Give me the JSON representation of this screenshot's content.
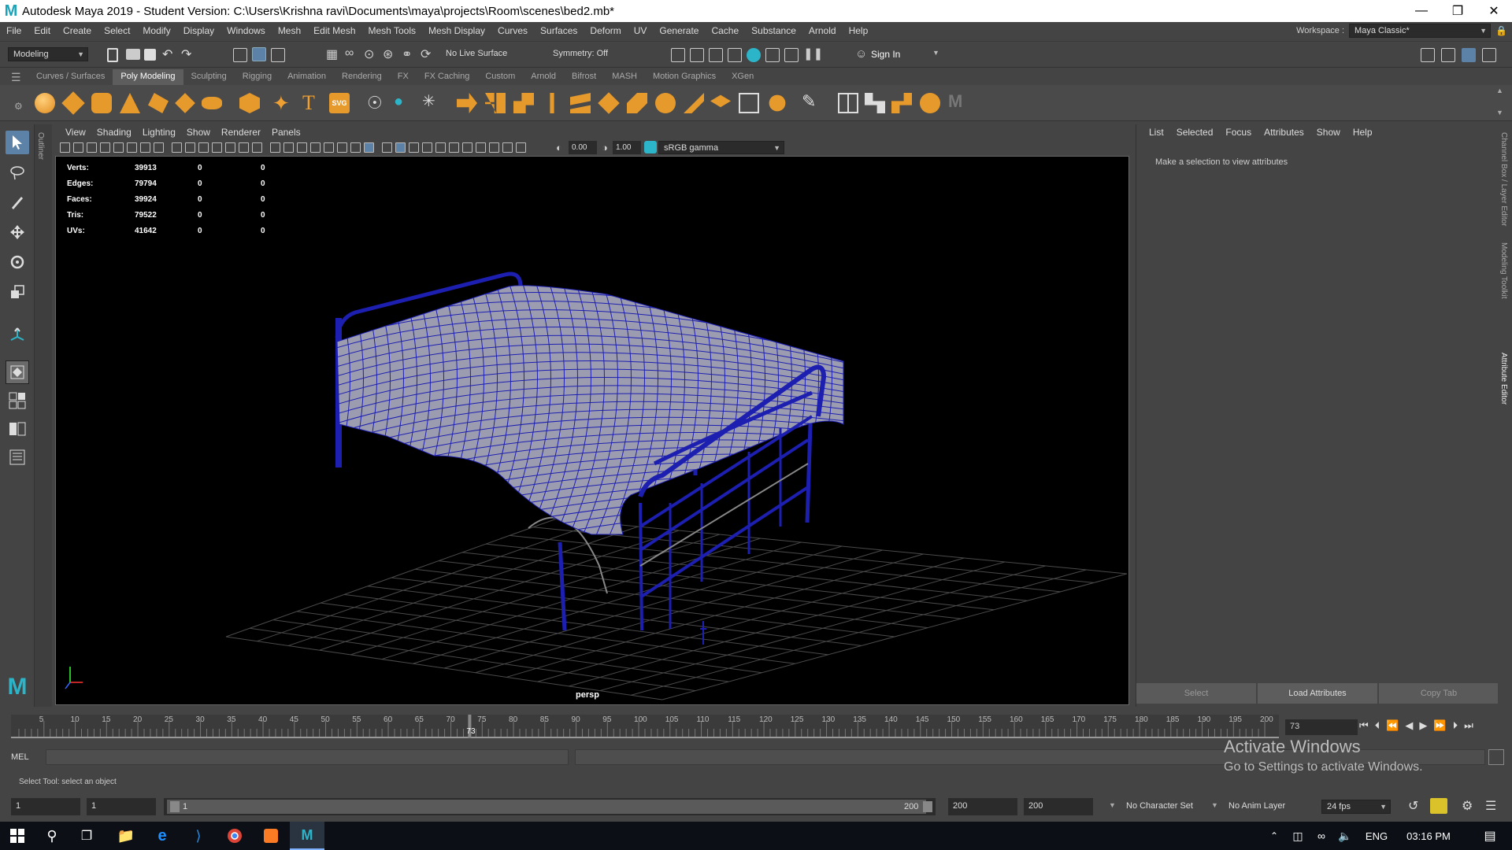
{
  "window": {
    "title": "Autodesk Maya 2019 - Student Version: C:\\Users\\Krishna ravi\\Documents\\maya\\projects\\Room\\scenes\\bed2.mb*"
  },
  "menubar": {
    "items": [
      "File",
      "Edit",
      "Create",
      "Select",
      "Modify",
      "Display",
      "Windows",
      "Mesh",
      "Edit Mesh",
      "Mesh Tools",
      "Mesh Display",
      "Curves",
      "Surfaces",
      "Deform",
      "UV",
      "Generate",
      "Cache",
      "Substance",
      "Arnold",
      "Help"
    ],
    "workspace_label": "Workspace :",
    "workspace_value": "Maya Classic*"
  },
  "statusline": {
    "menuset": "Modeling",
    "live_surface": "No Live Surface",
    "symmetry": "Symmetry: Off",
    "sign_in": "Sign In"
  },
  "shelf": {
    "tabs": [
      "Curves / Surfaces",
      "Poly Modeling",
      "Sculpting",
      "Rigging",
      "Animation",
      "Rendering",
      "FX",
      "FX Caching",
      "Custom",
      "Arnold",
      "Bifrost",
      "MASH",
      "Motion Graphics",
      "XGen"
    ],
    "active_tab": "Poly Modeling",
    "svg_label": "SVG"
  },
  "panel": {
    "menus": [
      "View",
      "Shading",
      "Lighting",
      "Show",
      "Renderer",
      "Panels"
    ],
    "exposure": "0.00",
    "gamma": "1.00",
    "color_space": "sRGB gamma"
  },
  "hud": {
    "rows": [
      {
        "label": "Verts:",
        "a": "39913",
        "b": "0",
        "c": "0"
      },
      {
        "label": "Edges:",
        "a": "79794",
        "b": "0",
        "c": "0"
      },
      {
        "label": "Faces:",
        "a": "39924",
        "b": "0",
        "c": "0"
      },
      {
        "label": "Tris:",
        "a": "79522",
        "b": "0",
        "c": "0"
      },
      {
        "label": "UVs:",
        "a": "41642",
        "b": "0",
        "c": "0"
      }
    ]
  },
  "viewport": {
    "camera": "persp",
    "outliner_label": "Outliner"
  },
  "attribute_editor": {
    "menus": [
      "List",
      "Selected",
      "Focus",
      "Attributes",
      "Show",
      "Help"
    ],
    "message": "Make a selection to view attributes",
    "buttons": [
      "Select",
      "Load Attributes",
      "Copy Tab"
    ],
    "side_tabs": [
      "Channel Box / Layer Editor",
      "Modeling Toolkit",
      "Attribute Editor"
    ]
  },
  "timeslider": {
    "ticks": [
      "5",
      "10",
      "15",
      "20",
      "25",
      "30",
      "35",
      "40",
      "45",
      "50",
      "55",
      "60",
      "65",
      "70",
      "75",
      "80",
      "85",
      "90",
      "95",
      "100",
      "105",
      "110",
      "115",
      "120",
      "125",
      "130",
      "135",
      "140",
      "145",
      "150",
      "155",
      "160",
      "165",
      "170",
      "175",
      "180",
      "185",
      "190",
      "195",
      "200"
    ],
    "current_frame": "73",
    "current_marker": "73"
  },
  "commandline": {
    "mel": "MEL",
    "help": "Select Tool: select an object"
  },
  "rangebar": {
    "start": "1",
    "playback_start": "1",
    "slider_start": "1",
    "slider_end": "200",
    "playback_end": "200",
    "end": "200",
    "character_set": "No Character Set",
    "anim_layer": "No Anim Layer",
    "fps": "24 fps"
  },
  "watermark": {
    "line1": "Activate Windows",
    "line2": "Go to Settings to activate Windows."
  },
  "taskbar": {
    "lang": "ENG",
    "time": "03:16 PM"
  }
}
